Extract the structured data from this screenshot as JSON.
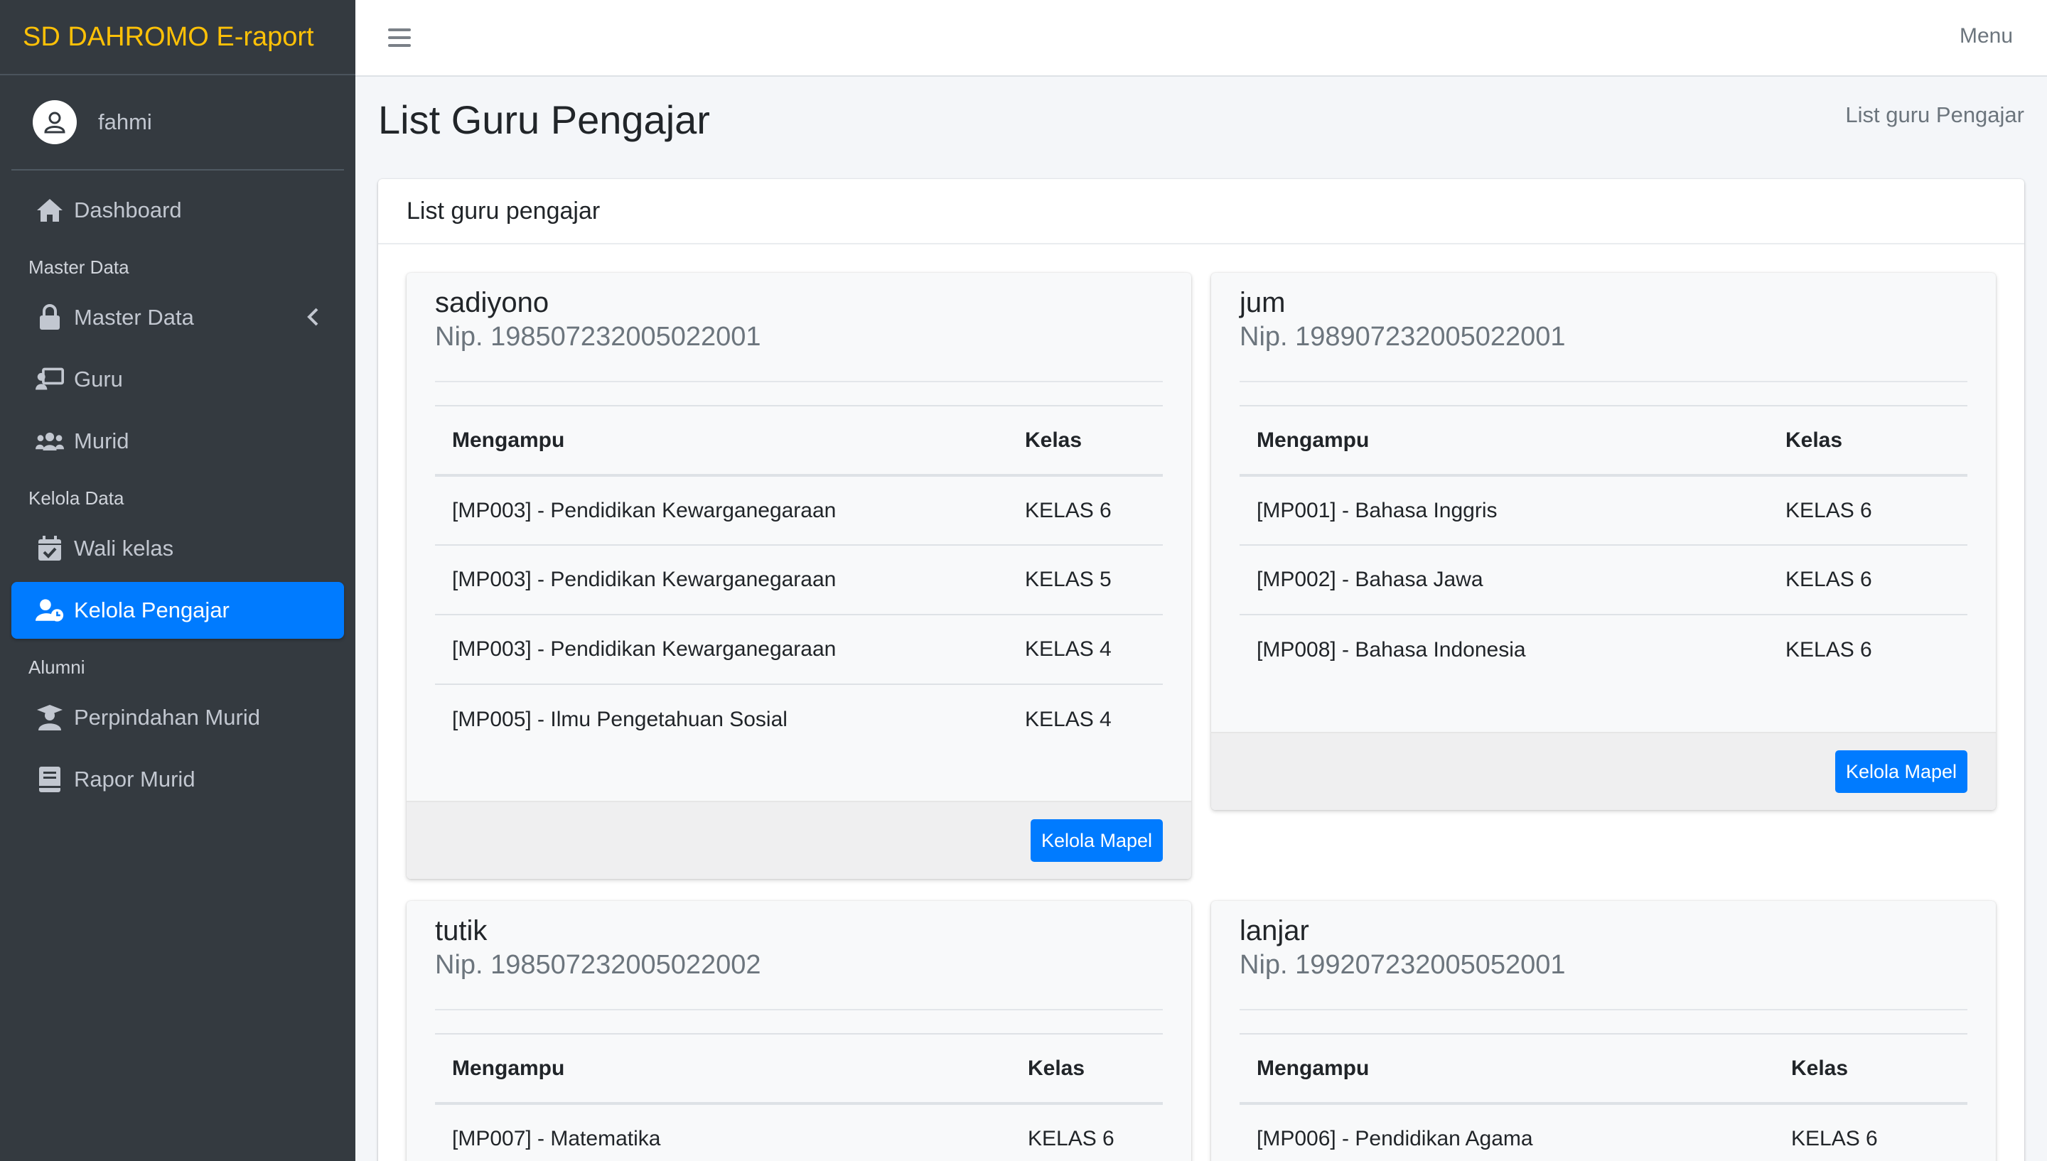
{
  "app": {
    "brand": "SD DAHROMO E-raport"
  },
  "user": {
    "name": "fahmi"
  },
  "sidebar": {
    "items": [
      {
        "label": "Dashboard",
        "icon": "home-icon"
      },
      {
        "header": "Master Data"
      },
      {
        "label": "Master Data",
        "icon": "lock-icon",
        "expandable": true
      },
      {
        "label": "Guru",
        "icon": "chalkboard-teacher-icon"
      },
      {
        "label": "Murid",
        "icon": "users-icon"
      },
      {
        "header": "Kelola Data"
      },
      {
        "label": "Wali kelas",
        "icon": "calendar-check-icon"
      },
      {
        "label": "Kelola Pengajar",
        "icon": "user-clock-icon",
        "active": true
      },
      {
        "header": "Alumni"
      },
      {
        "label": "Perpindahan Murid",
        "icon": "user-graduate-icon"
      },
      {
        "label": "Rapor Murid",
        "icon": "book-icon"
      }
    ]
  },
  "topbar": {
    "menu_label": "Menu"
  },
  "page": {
    "title": "List Guru Pengajar",
    "breadcrumb": "List guru Pengajar"
  },
  "card": {
    "title": "List guru pengajar"
  },
  "teachers": [
    {
      "name": "sadiyono",
      "nip": "Nip. 198507232005022001",
      "col_subject": "Mengampu",
      "col_class": "Kelas",
      "rows": [
        {
          "subject": "[MP003] - Pendidikan Kewarganegaraan",
          "class": "KELAS 6"
        },
        {
          "subject": "[MP003] - Pendidikan Kewarganegaraan",
          "class": "KELAS 5"
        },
        {
          "subject": "[MP003] - Pendidikan Kewarganegaraan",
          "class": "KELAS 4"
        },
        {
          "subject": "[MP005] - Ilmu Pengetahuan Sosial",
          "class": "KELAS 4"
        }
      ],
      "button": "Kelola Mapel"
    },
    {
      "name": "jum",
      "nip": "Nip. 198907232005022001",
      "col_subject": "Mengampu",
      "col_class": "Kelas",
      "rows": [
        {
          "subject": "[MP001] - Bahasa Inggris",
          "class": "KELAS 6"
        },
        {
          "subject": "[MP002] - Bahasa Jawa",
          "class": "KELAS 6"
        },
        {
          "subject": "[MP008] - Bahasa Indonesia",
          "class": "KELAS 6"
        }
      ],
      "button": "Kelola Mapel"
    },
    {
      "name": "tutik",
      "nip": "Nip. 198507232005022002",
      "col_subject": "Mengampu",
      "col_class": "Kelas",
      "rows": [
        {
          "subject": "[MP007] - Matematika",
          "class": "KELAS 6"
        }
      ]
    },
    {
      "name": "lanjar",
      "nip": "Nip. 199207232005052001",
      "col_subject": "Mengampu",
      "col_class": "Kelas",
      "rows": [
        {
          "subject": "[MP006] - Pendidikan Agama",
          "class": "KELAS 6"
        }
      ]
    }
  ],
  "colors": {
    "sidebar_bg": "#343a40",
    "brand": "#ffc107",
    "accent": "#007bff"
  }
}
